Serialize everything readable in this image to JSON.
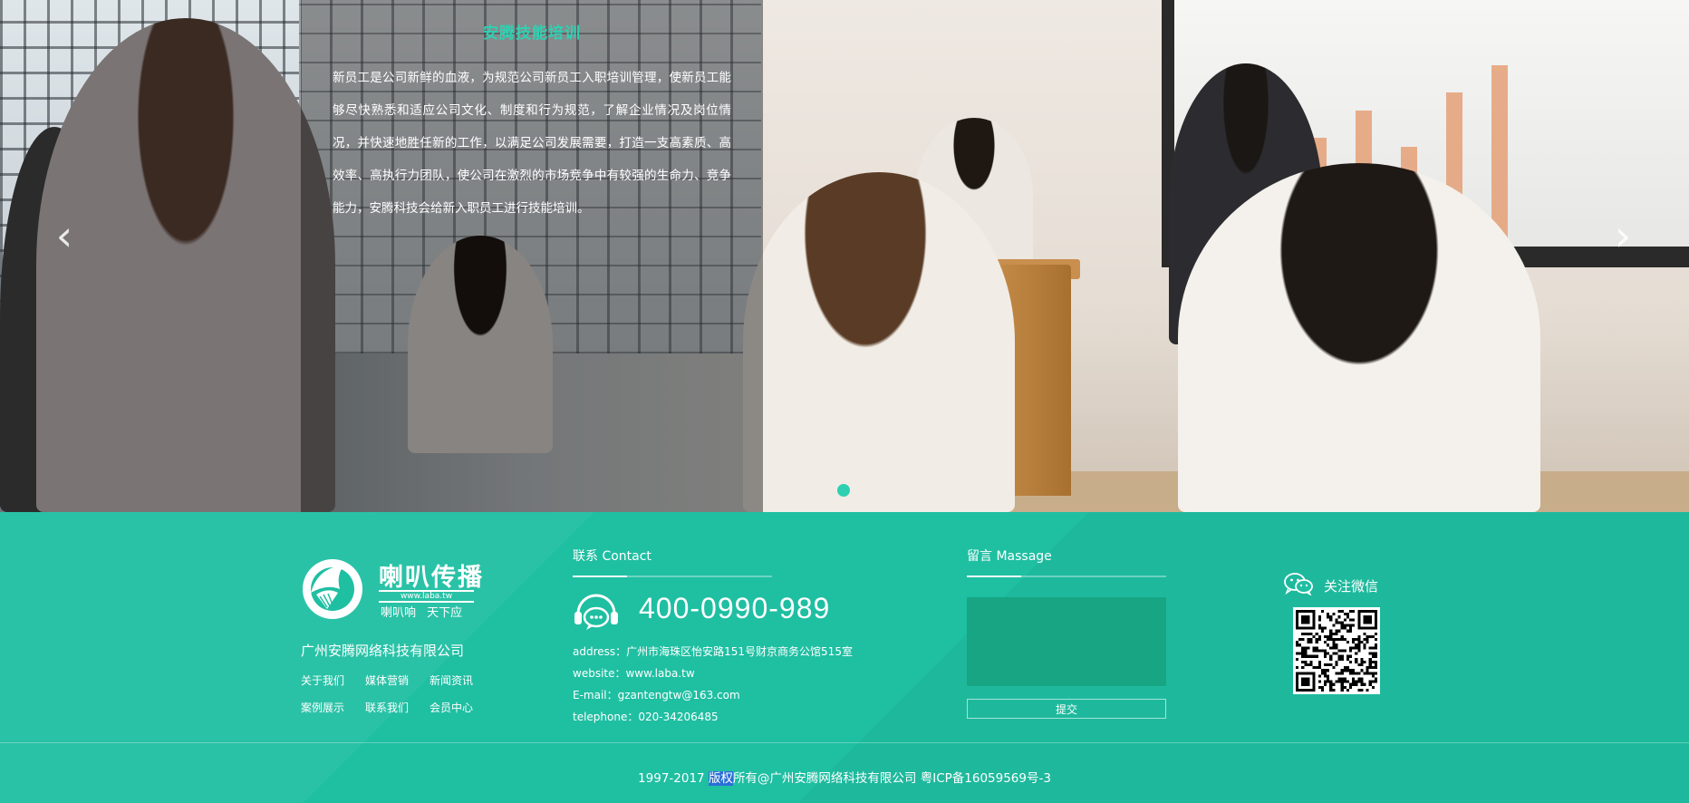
{
  "hero": {
    "title": "安腾技能培训",
    "description": "新员工是公司新鲜的血液，为规范公司新员工入职培训管理，使新员工能够尽快熟悉和适应公司文化、制度和行为规范，了解企业情况及岗位情况，并快速地胜任新的工作，以满足公司发展需要，打造一支高素质、高效率、高执行力团队，使公司在激烈的市场竞争中有较强的生命力、竞争能力，安腾科技会给新入职员工进行技能培训。",
    "prev_arrow": "‹",
    "next_arrow": "›",
    "slide_count": 1,
    "active_slide": 1,
    "accent_color": "#2fd0b2"
  },
  "footer": {
    "background_color": "#1fbfa2",
    "logo": {
      "name": "喇叭传播",
      "url": "www.laba.tw",
      "slogan": "喇叭响 天下应"
    },
    "company_name": "广州安腾网络科技有限公司",
    "links": [
      "关于我们",
      "媒体营销",
      "新闻资讯",
      "案例展示",
      "联系我们",
      "会员中心"
    ],
    "contact": {
      "title": "联系 Contact",
      "phone": "400-0990-989",
      "address": "address：广州市海珠区怡安路151号财京商务公馆515室",
      "website": "website：www.laba.tw",
      "email": "E-mail：gzantengtw@163.com",
      "telephone": "telephone：020-34206485",
      "phone_icon": "headset-phone-icon"
    },
    "message": {
      "title": "留言 Massage",
      "textarea_value": "",
      "submit_label": "提交"
    },
    "wechat": {
      "label": "关注微信",
      "icon": "wechat-icon"
    },
    "copyright": {
      "prefix": "1997-2017 ",
      "highlighted": "版权",
      "suffix": "所有@广州安腾网络科技有限公司 粤ICP备16059569号-3"
    }
  }
}
